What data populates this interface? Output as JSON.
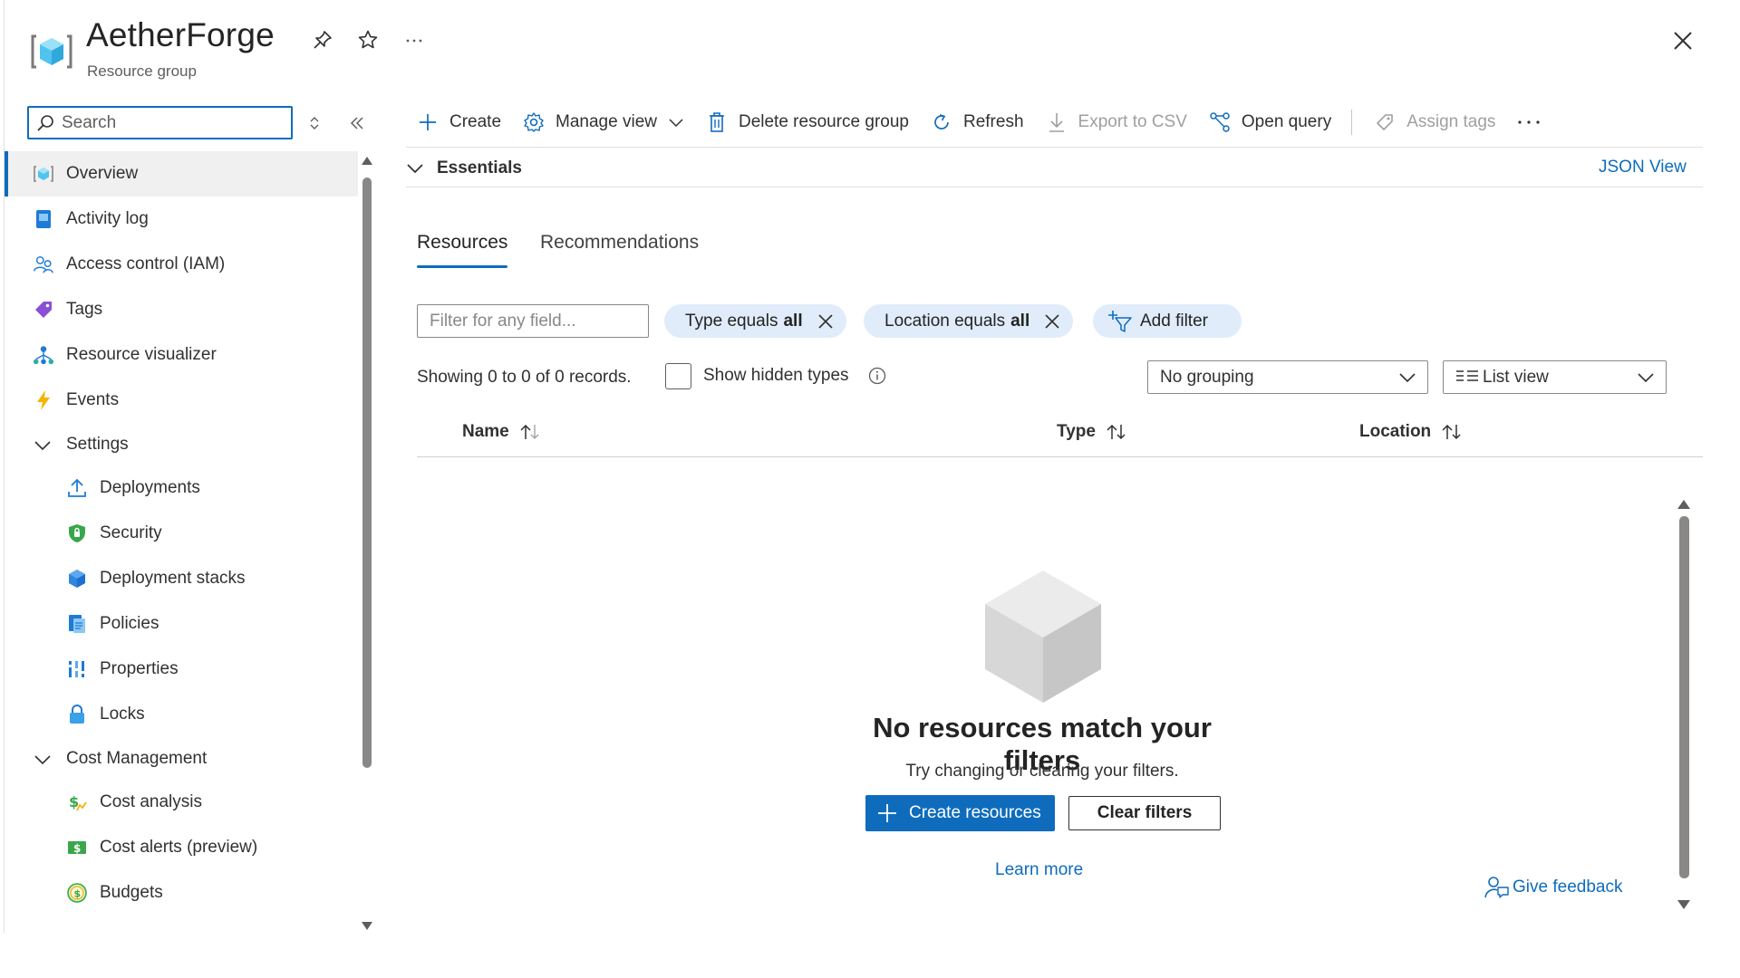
{
  "header": {
    "title": "AetherForge",
    "subtitle": "Resource group",
    "icons": [
      "resource-group-icon",
      "pin-icon",
      "star-icon",
      "more-icon",
      "close-icon"
    ]
  },
  "sidebar": {
    "search_placeholder": "Search",
    "items": [
      {
        "label": "Overview",
        "icon": "overview-icon",
        "active": true
      },
      {
        "label": "Activity log",
        "icon": "activity-log-icon"
      },
      {
        "label": "Access control (IAM)",
        "icon": "iam-icon"
      },
      {
        "label": "Tags",
        "icon": "tag-icon"
      },
      {
        "label": "Resource visualizer",
        "icon": "visualizer-icon"
      },
      {
        "label": "Events",
        "icon": "lightning-icon"
      }
    ],
    "settings": {
      "label": "Settings",
      "items": [
        {
          "label": "Deployments",
          "icon": "upload-icon"
        },
        {
          "label": "Security",
          "icon": "shield-icon"
        },
        {
          "label": "Deployment stacks",
          "icon": "cube-stack-icon"
        },
        {
          "label": "Policies",
          "icon": "policy-icon"
        },
        {
          "label": "Properties",
          "icon": "properties-icon"
        },
        {
          "label": "Locks",
          "icon": "lock-icon"
        }
      ]
    },
    "cost": {
      "label": "Cost Management",
      "items": [
        {
          "label": "Cost analysis",
          "icon": "cost-analysis-icon"
        },
        {
          "label": "Cost alerts (preview)",
          "icon": "cost-alert-icon"
        },
        {
          "label": "Budgets",
          "icon": "budget-icon"
        }
      ]
    }
  },
  "toolbar": {
    "create": "Create",
    "manage_view": "Manage view",
    "delete": "Delete resource group",
    "refresh": "Refresh",
    "export": "Export to CSV",
    "open_query": "Open query",
    "assign_tags": "Assign tags"
  },
  "essentials": {
    "label": "Essentials",
    "json_view": "JSON View"
  },
  "tabs": [
    {
      "label": "Resources",
      "active": true
    },
    {
      "label": "Recommendations",
      "active": false
    }
  ],
  "filters": {
    "placeholder": "Filter for any field...",
    "type_prefix": "Type equals",
    "type_value": "all",
    "location_prefix": "Location equals",
    "location_value": "all",
    "add_filter": "Add filter"
  },
  "list": {
    "records": "Showing 0 to 0 of 0 records.",
    "show_hidden": "Show hidden types",
    "grouping": "No grouping",
    "view": "List view",
    "columns": [
      "Name",
      "Type",
      "Location"
    ]
  },
  "empty_state": {
    "title": "No resources match your filters",
    "subtitle": "Try changing or clearing your filters.",
    "create_button": "Create resources",
    "clear_button": "Clear filters",
    "learn_more": "Learn more"
  },
  "feedback": "Give feedback",
  "colors": {
    "accent": "#0f6cbd",
    "pill_bg": "#e0ecfa",
    "active_nav_bg": "#f0f0f0"
  }
}
